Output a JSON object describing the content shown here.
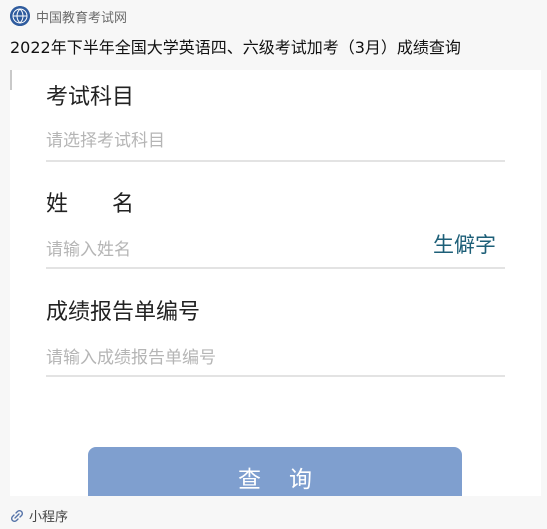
{
  "source": {
    "name": "中国教育考试网",
    "logo_icon": "globe-logo-icon"
  },
  "article": {
    "title": "2022年下半年全国大学英语四、六级考试加考（3月）成绩查询"
  },
  "form": {
    "subject": {
      "label": "考试科目",
      "placeholder": "请选择考试科目"
    },
    "name": {
      "label": "姓　　名",
      "placeholder": "请输入姓名",
      "rare_char_label": "生僻字"
    },
    "report_no": {
      "label": "成绩报告单编号",
      "placeholder": "请输入成绩报告单编号"
    },
    "submit_label": "查询"
  },
  "footer": {
    "label": "小程序",
    "icon": "link-icon"
  },
  "colors": {
    "button": "#7f9fcf",
    "rare_char": "#1d5f78",
    "placeholder": "#b5b5b5"
  }
}
